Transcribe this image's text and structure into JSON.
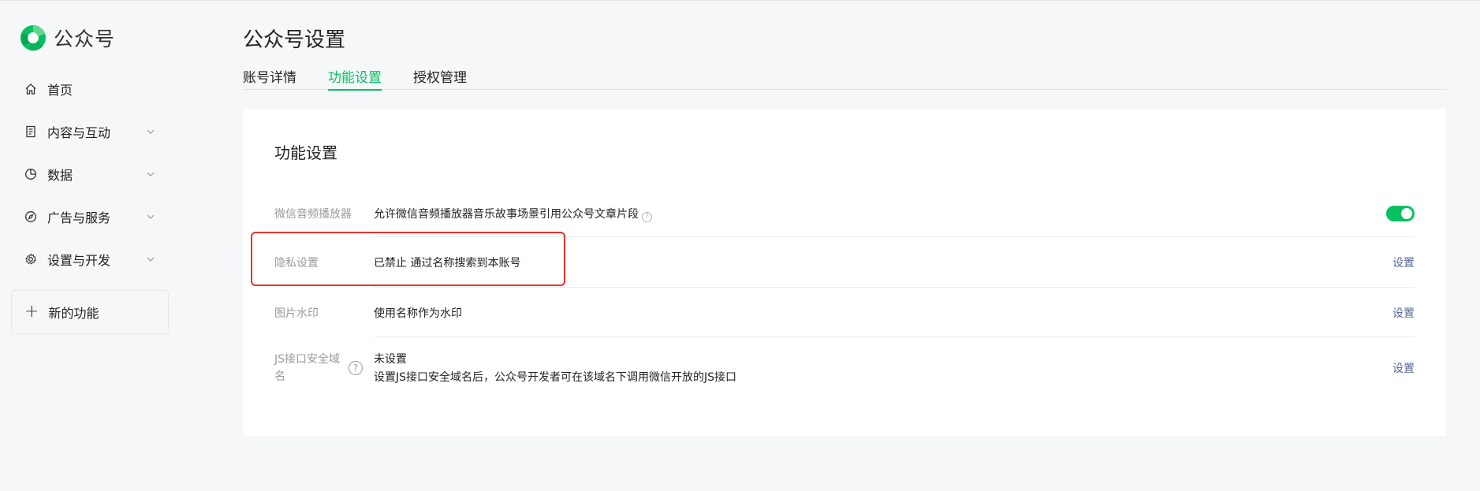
{
  "app": {
    "name": "公众号",
    "brand_color": "#07c160"
  },
  "sidebar": {
    "items": [
      {
        "label": "首页",
        "icon": "home-icon",
        "expandable": false
      },
      {
        "label": "内容与互动",
        "icon": "document-icon",
        "expandable": true
      },
      {
        "label": "数据",
        "icon": "pie-chart-icon",
        "expandable": true
      },
      {
        "label": "广告与服务",
        "icon": "compass-icon",
        "expandable": true
      },
      {
        "label": "设置与开发",
        "icon": "gear-icon",
        "expandable": true
      }
    ],
    "new_feature": {
      "label": "新的功能",
      "icon": "plus-icon"
    }
  },
  "page": {
    "title": "公众号设置",
    "tabs": [
      {
        "label": "账号详情",
        "active": false
      },
      {
        "label": "功能设置",
        "active": true
      },
      {
        "label": "授权管理",
        "active": false
      }
    ]
  },
  "card": {
    "title": "功能设置",
    "rows": [
      {
        "key": "微信音频播放器",
        "value": "允许微信音频播放器音乐故事场景引用公众号文章片段",
        "control": "toggle",
        "toggle_on": true
      },
      {
        "key": "隐私设置",
        "value": "已禁止 通过名称搜索到本账号",
        "action": "设置",
        "highlighted": true
      },
      {
        "key": "图片水印",
        "value": "使用名称作为水印",
        "action": "设置"
      },
      {
        "key": "JS接口安全域名",
        "key_line1": "JS接口安全域",
        "key_line2": "名",
        "value": "未设置",
        "value_line2": "设置JS接口安全域名后，公众号开发者可在该域名下调用微信开放的JS接口",
        "action": "设置"
      }
    ]
  },
  "annotation": {
    "color": "#e8322d"
  }
}
